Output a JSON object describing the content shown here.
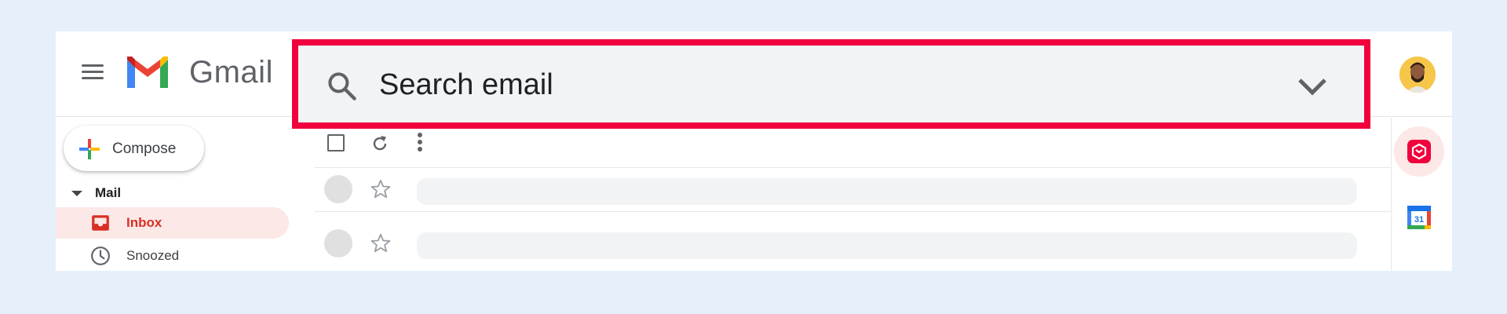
{
  "header": {
    "app_name": "Gmail",
    "search_placeholder": "Search email"
  },
  "compose": {
    "label": "Compose"
  },
  "nav": {
    "section_label": "Mail",
    "items": [
      {
        "label": "Inbox",
        "icon": "inbox-icon",
        "active": true
      },
      {
        "label": "Snoozed",
        "icon": "clock-icon",
        "active": false
      }
    ]
  },
  "toolbar": {
    "icons": [
      "checkbox-icon",
      "refresh-icon",
      "more-vert-icon"
    ]
  },
  "rows": [
    {
      "icons": [
        "avatar-placeholder",
        "star-icon"
      ]
    },
    {
      "icons": [
        "avatar-placeholder",
        "star-icon"
      ]
    }
  ],
  "addons": [
    {
      "name": "addon-icon",
      "active": true
    },
    {
      "name": "calendar-icon",
      "calendar_day": "31"
    }
  ],
  "colors": {
    "highlight_border": "#f0003c",
    "active_nav_bg": "#fce8e6",
    "active_nav_text": "#d93025",
    "page_bg": "#e6f0fb"
  }
}
